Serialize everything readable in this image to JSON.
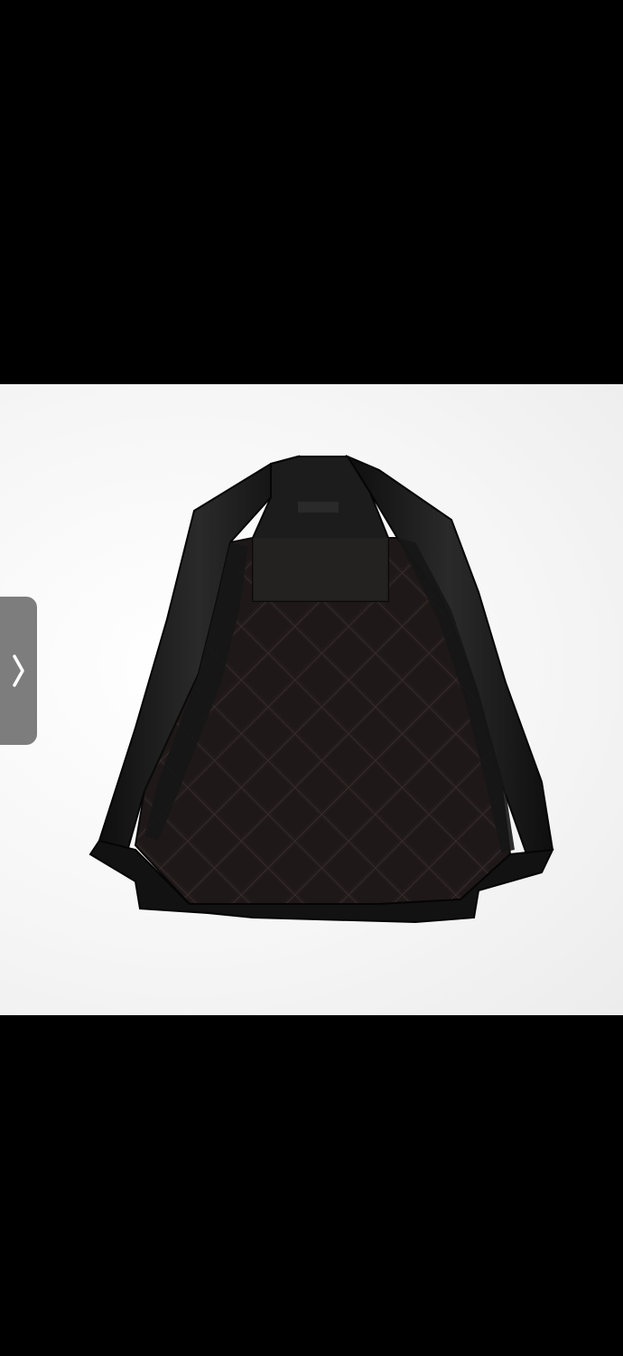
{
  "viewer": {
    "background_color": "#000000",
    "photo_background_color": "#f4f4f4",
    "product_image": {
      "subject_icon": "leather-jacket-quilted-lining-icon",
      "leather_color": "#141414",
      "lining_color": "#231c1c",
      "stitch_color": "#3a2f2f"
    },
    "next_button": {
      "icon": "chevron-right-icon",
      "color": "#7d7d7d"
    }
  }
}
